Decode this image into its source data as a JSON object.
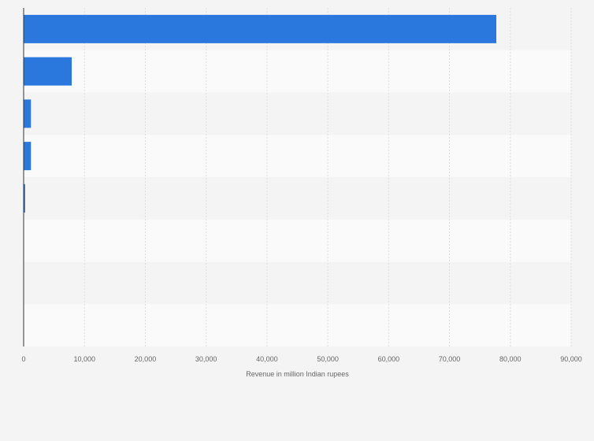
{
  "chart_data": {
    "type": "bar",
    "orientation": "horizontal",
    "categories": [
      "",
      "",
      "",
      "",
      "",
      "",
      "",
      ""
    ],
    "values": [
      77700,
      7900,
      1200,
      1200,
      250,
      0,
      0,
      0
    ],
    "xlabel": "Revenue in million Indian rupees",
    "ylabel": "",
    "xlim": [
      0,
      90000
    ],
    "xticks": [
      0,
      10000,
      20000,
      30000,
      40000,
      50000,
      60000,
      70000,
      80000,
      90000
    ],
    "xtick_labels": [
      "0",
      "10,000",
      "20,000",
      "30,000",
      "40,000",
      "50,000",
      "60,000",
      "70,000",
      "80,000",
      "90,000"
    ],
    "grid": true,
    "legend": "none",
    "colors": {
      "bar": "#2a78de",
      "band_a": "#f4f4f4",
      "band_b": "#fafafa",
      "grid": "#dddddd",
      "axis": "#333333"
    }
  }
}
